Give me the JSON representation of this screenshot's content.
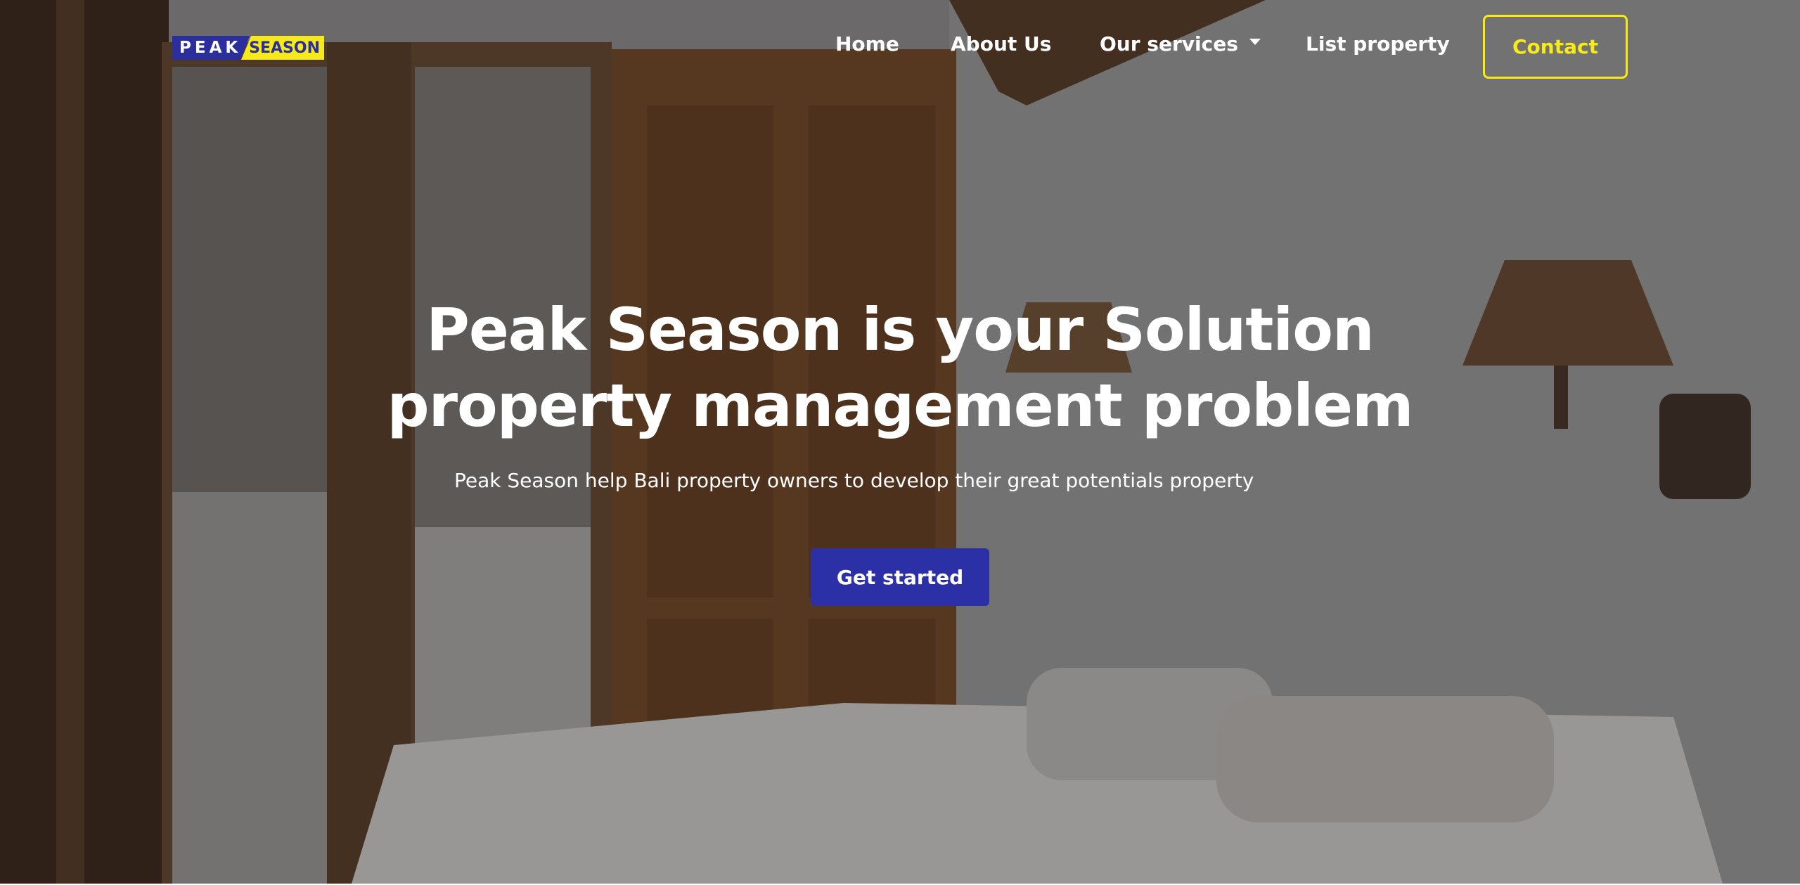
{
  "brand": {
    "logo_left": "PEAK",
    "logo_right": "SEASON",
    "primary_color": "#2b2f9e",
    "accent_color": "#f6ea1a"
  },
  "nav": {
    "home": "Home",
    "about": "About Us",
    "services": "Our services",
    "services_icon": "chevron-down-icon",
    "list_property": "List property",
    "contact": "Contact"
  },
  "hero": {
    "title_line1": "Peak Season is your Solution",
    "title_line2": "property management problem",
    "subtitle": "Peak Season help Bali property owners to develop their great potentials property",
    "cta": "Get started",
    "background": "bedroom-photo"
  }
}
